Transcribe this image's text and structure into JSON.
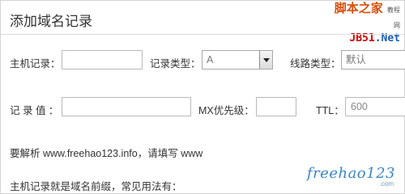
{
  "header": {
    "title": "添加域名记录"
  },
  "watermark_top": {
    "line1": "脚本之家",
    "line1_small": "教程网",
    "line2_a": "JB51",
    "line2_b": ".Net"
  },
  "form": {
    "host_label": "主机记录：",
    "type_label": "记录类型：",
    "type_value": "A",
    "line_label": "线路类型：",
    "line_value": "默认",
    "value_label": "记 录 值 ：",
    "mx_label": "MX优先级：",
    "ttl_label": "TTL：",
    "ttl_value": "600"
  },
  "notes": {
    "hint": "要解析 www.freehao123.info，请填写 www",
    "desc": "主机记录就是域名前缀，常见用法有："
  },
  "watermark_bottom": {
    "brand": "freehao123",
    "sub": ".com"
  }
}
